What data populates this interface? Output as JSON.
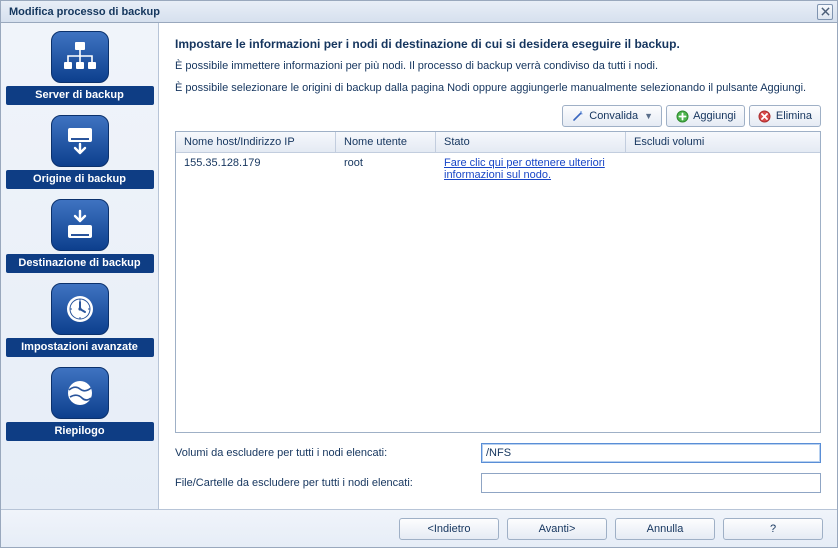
{
  "window": {
    "title": "Modifica processo di backup"
  },
  "sidebar": {
    "items": [
      {
        "label": "Server di backup"
      },
      {
        "label": "Origine di backup"
      },
      {
        "label": "Destinazione di backup"
      },
      {
        "label": "Impostazioni avanzate"
      },
      {
        "label": "Riepilogo"
      }
    ]
  },
  "main": {
    "heading": "Impostare le informazioni per i nodi di destinazione di cui si desidera eseguire il backup.",
    "para1": "È possibile immettere informazioni per più nodi. Il processo di backup verrà condiviso da tutti i nodi.",
    "para2": "È possibile selezionare le origini di backup dalla pagina Nodi oppure aggiungerle manualmente selezionando il pulsante Aggiungi."
  },
  "toolbar": {
    "validate": "Convalida",
    "add": "Aggiungi",
    "delete": "Elimina"
  },
  "grid": {
    "columns": {
      "host": "Nome host/Indirizzo IP",
      "user": "Nome utente",
      "status": "Stato",
      "exclude": "Escludi volumi"
    },
    "rows": [
      {
        "host": "155.35.128.179",
        "user": "root",
        "status_link": "Fare clic qui per ottenere ulteriori informazioni sul nodo.",
        "exclude": ""
      }
    ]
  },
  "form": {
    "volumes_label": "Volumi da escludere per tutti i nodi elencati:",
    "volumes_value": "/NFS",
    "files_label": "File/Cartelle da escludere per tutti i nodi elencati:",
    "files_value": ""
  },
  "footer": {
    "back": "<Indietro",
    "next": "Avanti>",
    "cancel": "Annulla",
    "help": "?"
  }
}
